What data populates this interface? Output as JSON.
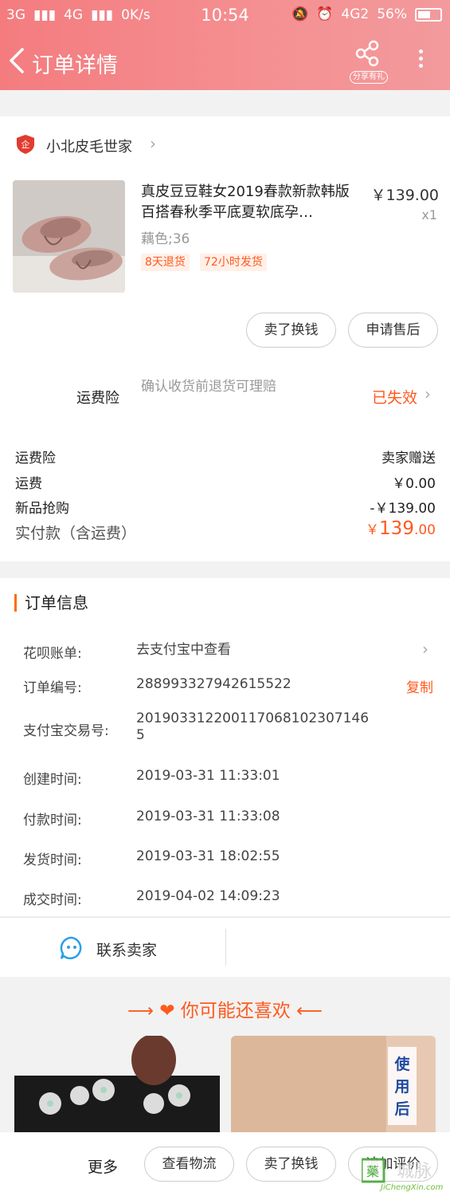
{
  "status_bar": {
    "signal1": "3G",
    "signal2": "4G",
    "speed": "0K/s",
    "time": "10:54",
    "network": "4G2",
    "battery": "56%"
  },
  "nav": {
    "title": "订单详情",
    "share_label": "分享有礼",
    "back_icon": "chevron-left-icon",
    "share_icon": "share-icon",
    "more_icon": "more-vertical-icon"
  },
  "shop": {
    "name": "小北皮毛世家",
    "badge_char": "企"
  },
  "item": {
    "title": "真皮豆豆鞋女2019春款新款韩版百搭春秋季平底夏软底孕…",
    "price": "￥139.00",
    "qty": "x1",
    "sku": "藕色;36",
    "tags": [
      "8天退货",
      "72小时发货"
    ]
  },
  "actions": {
    "sell": "卖了换钱",
    "after_sale": "申请售后"
  },
  "insurance": {
    "label": "运费险",
    "desc": "确认收货前退货可理赔",
    "status": "已失效"
  },
  "fees": [
    {
      "label": "运费险",
      "value": "卖家赠送"
    },
    {
      "label": "运费",
      "value": "￥0.00"
    },
    {
      "label": "新品抢购",
      "value": "-￥139.00"
    }
  ],
  "paid": {
    "label": "实付款（含运费）",
    "currency": "￥",
    "integer": "139",
    "decimal": ".00"
  },
  "order_info": {
    "title": "订单信息",
    "rows": [
      {
        "label": "花呗账单:",
        "value": "去支付宝中查看"
      },
      {
        "label": "订单编号:",
        "value": "288993327942615522"
      },
      {
        "label": "支付宝交易号:",
        "value": "2019033122001170681023071465"
      },
      {
        "label": "创建时间:",
        "value": "2019-03-31 11:33:01"
      },
      {
        "label": "付款时间:",
        "value": "2019-03-31 11:33:08"
      },
      {
        "label": "发货时间:",
        "value": "2019-03-31 18:02:55"
      },
      {
        "label": "成交时间:",
        "value": "2019-04-02 14:09:23"
      }
    ],
    "copy_label": "复制"
  },
  "contact": {
    "label": "联系卖家"
  },
  "recommend": {
    "title": "你可能还喜欢",
    "card2_text": [
      "使",
      "用",
      "后"
    ]
  },
  "bottom": {
    "more": "更多",
    "logistics": "查看物流",
    "sell": "卖了换钱",
    "review": "追加评价"
  },
  "watermark": {
    "text": "JiChengXin.com"
  },
  "colors": {
    "header": "#f47c7f",
    "accent": "#ff5a1f",
    "tag_bg": "#fff0e8"
  }
}
